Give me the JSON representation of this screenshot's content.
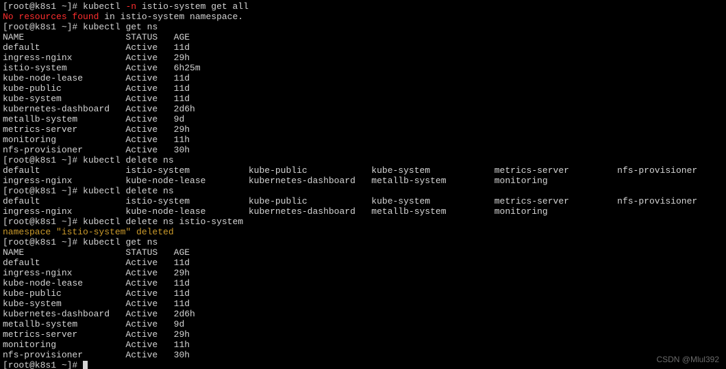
{
  "prompt": "[root@k8s1 ~]# ",
  "cmd1": {
    "pre": "kubectl ",
    "flag": "-n",
    "post": " istio-system get all"
  },
  "line_err": {
    "red": "No resources found",
    "rest": " in istio-system namespace."
  },
  "cmd2": "kubectl get ns",
  "ns1": {
    "header": {
      "name": "NAME",
      "status": "STATUS",
      "age": "AGE"
    },
    "rows": [
      {
        "name": "default",
        "status": "Active",
        "age": "11d"
      },
      {
        "name": "ingress-nginx",
        "status": "Active",
        "age": "29h"
      },
      {
        "name": "istio-system",
        "status": "Active",
        "age": "6h25m"
      },
      {
        "name": "kube-node-lease",
        "status": "Active",
        "age": "11d"
      },
      {
        "name": "kube-public",
        "status": "Active",
        "age": "11d"
      },
      {
        "name": "kube-system",
        "status": "Active",
        "age": "11d"
      },
      {
        "name": "kubernetes-dashboard",
        "status": "Active",
        "age": "2d6h"
      },
      {
        "name": "metallb-system",
        "status": "Active",
        "age": "9d"
      },
      {
        "name": "metrics-server",
        "status": "Active",
        "age": "29h"
      },
      {
        "name": "monitoring",
        "status": "Active",
        "age": "11h"
      },
      {
        "name": "nfs-provisioner",
        "status": "Active",
        "age": "30h"
      }
    ]
  },
  "cmd3": "kubectl delete ns ",
  "completions1": {
    "r1": [
      "default",
      "istio-system",
      "kube-public",
      "kube-system",
      "metrics-server",
      "nfs-provisioner"
    ],
    "r2": [
      "ingress-nginx",
      "kube-node-lease",
      "kubernetes-dashboard",
      "metallb-system",
      "monitoring",
      ""
    ]
  },
  "cmd4": "kubectl delete ns ",
  "completions2": {
    "r1": [
      "default",
      "istio-system",
      "kube-public",
      "kube-system",
      "metrics-server",
      "nfs-provisioner"
    ],
    "r2": [
      "ingress-nginx",
      "kube-node-lease",
      "kubernetes-dashboard",
      "metallb-system",
      "monitoring",
      ""
    ]
  },
  "cmd5": "kubectl delete ns istio-system",
  "delete_out": "namespace \"istio-system\" deleted",
  "cmd6": "kubectl get ns",
  "ns2": {
    "header": {
      "name": "NAME",
      "status": "STATUS",
      "age": "AGE"
    },
    "rows": [
      {
        "name": "default",
        "status": "Active",
        "age": "11d"
      },
      {
        "name": "ingress-nginx",
        "status": "Active",
        "age": "29h"
      },
      {
        "name": "kube-node-lease",
        "status": "Active",
        "age": "11d"
      },
      {
        "name": "kube-public",
        "status": "Active",
        "age": "11d"
      },
      {
        "name": "kube-system",
        "status": "Active",
        "age": "11d"
      },
      {
        "name": "kubernetes-dashboard",
        "status": "Active",
        "age": "2d6h"
      },
      {
        "name": "metallb-system",
        "status": "Active",
        "age": "9d"
      },
      {
        "name": "metrics-server",
        "status": "Active",
        "age": "29h"
      },
      {
        "name": "monitoring",
        "status": "Active",
        "age": "11h"
      },
      {
        "name": "nfs-provisioner",
        "status": "Active",
        "age": "30h"
      }
    ]
  },
  "watermark": "CSDN @Mlul392",
  "cols": {
    "ns_name_w": 23,
    "ns_status_w": 9,
    "comp_col_w": 23
  }
}
